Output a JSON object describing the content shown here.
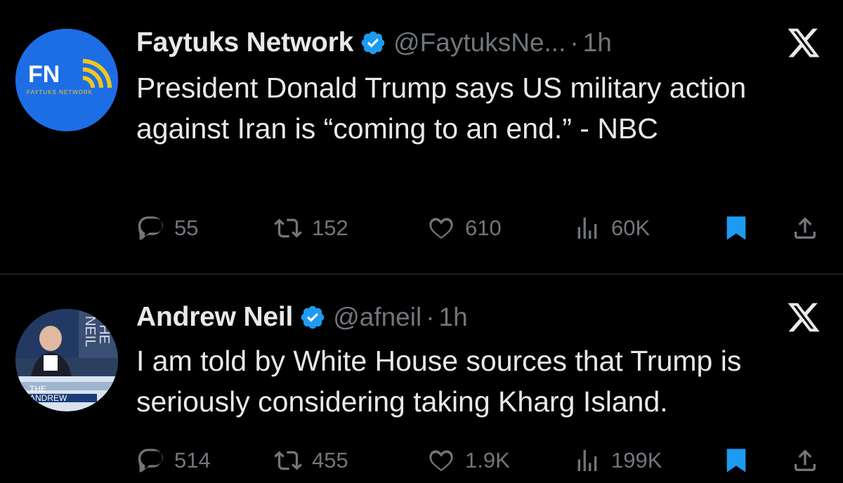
{
  "colors": {
    "background": "#000000",
    "text_primary": "#e7e9ea",
    "text_secondary": "#71767b",
    "verified_blue": "#1d9bf0",
    "bookmark_blue": "#1d9bf0",
    "faytuks_avatar_bg": "#1d6ee5",
    "faytuks_logo_yellow": "#f5c518"
  },
  "tweets": [
    {
      "avatar": {
        "icon": "faytuks-network-logo",
        "logo_text": "FN",
        "logo_subtext": "FAYTUKS NETWORK"
      },
      "display_name": "Faytuks Network",
      "verified": true,
      "handle": "@FaytuksNe...",
      "separator": "·",
      "time": "1h",
      "text": "President Donald Trump says US military action against Iran is “coming to an end.” - NBC",
      "stats": {
        "replies": "55",
        "retweets": "152",
        "likes": "610",
        "views": "60K"
      },
      "bookmarked": true
    },
    {
      "avatar": {
        "icon": "andrew-neil-photo",
        "logo_text_1": "THE",
        "logo_text_2": "NEIL",
        "banner_text_1": "THE",
        "banner_text_2": "ANDREW"
      },
      "display_name": "Andrew Neil",
      "verified": true,
      "handle": "@afneil",
      "separator": "·",
      "time": "1h",
      "text": "I am told by White House sources that Trump is seriously considering taking Kharg Island.",
      "stats": {
        "replies": "514",
        "retweets": "455",
        "likes": "1.9K",
        "views": "199K"
      },
      "bookmarked": true
    }
  ]
}
